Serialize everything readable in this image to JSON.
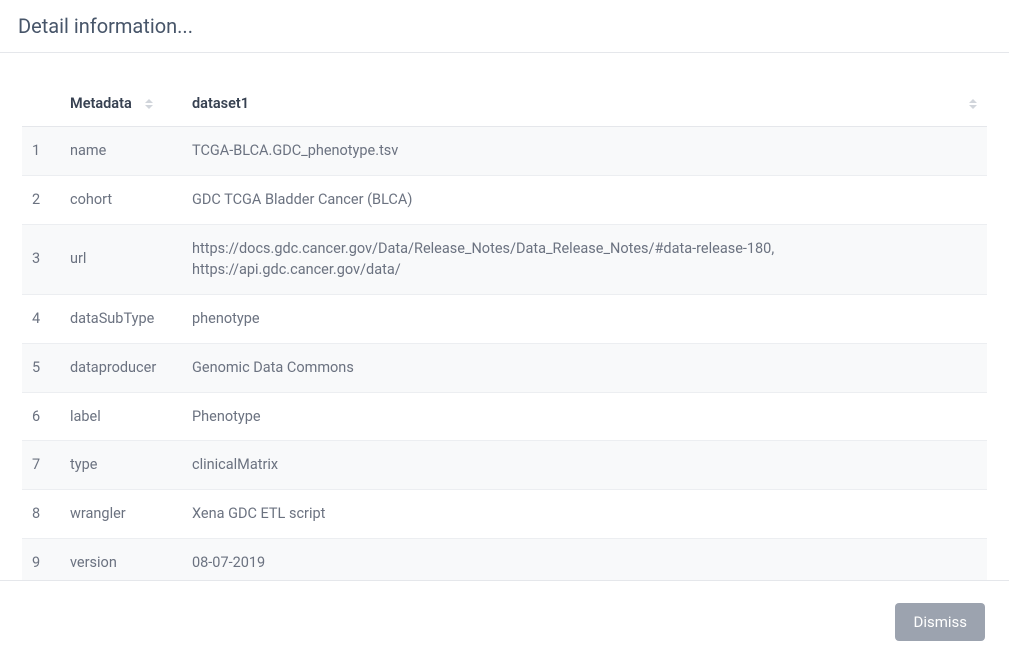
{
  "header": {
    "title": "Detail information..."
  },
  "table": {
    "columns": {
      "metadata_label": "Metadata",
      "dataset_label": "dataset1"
    },
    "rows": [
      {
        "index": "1",
        "key": "name",
        "value": "TCGA-BLCA.GDC_phenotype.tsv"
      },
      {
        "index": "2",
        "key": "cohort",
        "value": "GDC TCGA Bladder Cancer (BLCA)"
      },
      {
        "index": "3",
        "key": "url",
        "value": "https://docs.gdc.cancer.gov/Data/Release_Notes/Data_Release_Notes/#data-release-180, https://api.gdc.cancer.gov/data/"
      },
      {
        "index": "4",
        "key": "dataSubType",
        "value": "phenotype"
      },
      {
        "index": "5",
        "key": "dataproducer",
        "value": "Genomic Data Commons"
      },
      {
        "index": "6",
        "key": "label",
        "value": "Phenotype"
      },
      {
        "index": "7",
        "key": "type",
        "value": "clinicalMatrix"
      },
      {
        "index": "8",
        "key": "wrangler",
        "value": "Xena GDC ETL script"
      },
      {
        "index": "9",
        "key": "version",
        "value": "08-07-2019"
      }
    ]
  },
  "footer": {
    "dismiss_label": "Dismiss"
  }
}
